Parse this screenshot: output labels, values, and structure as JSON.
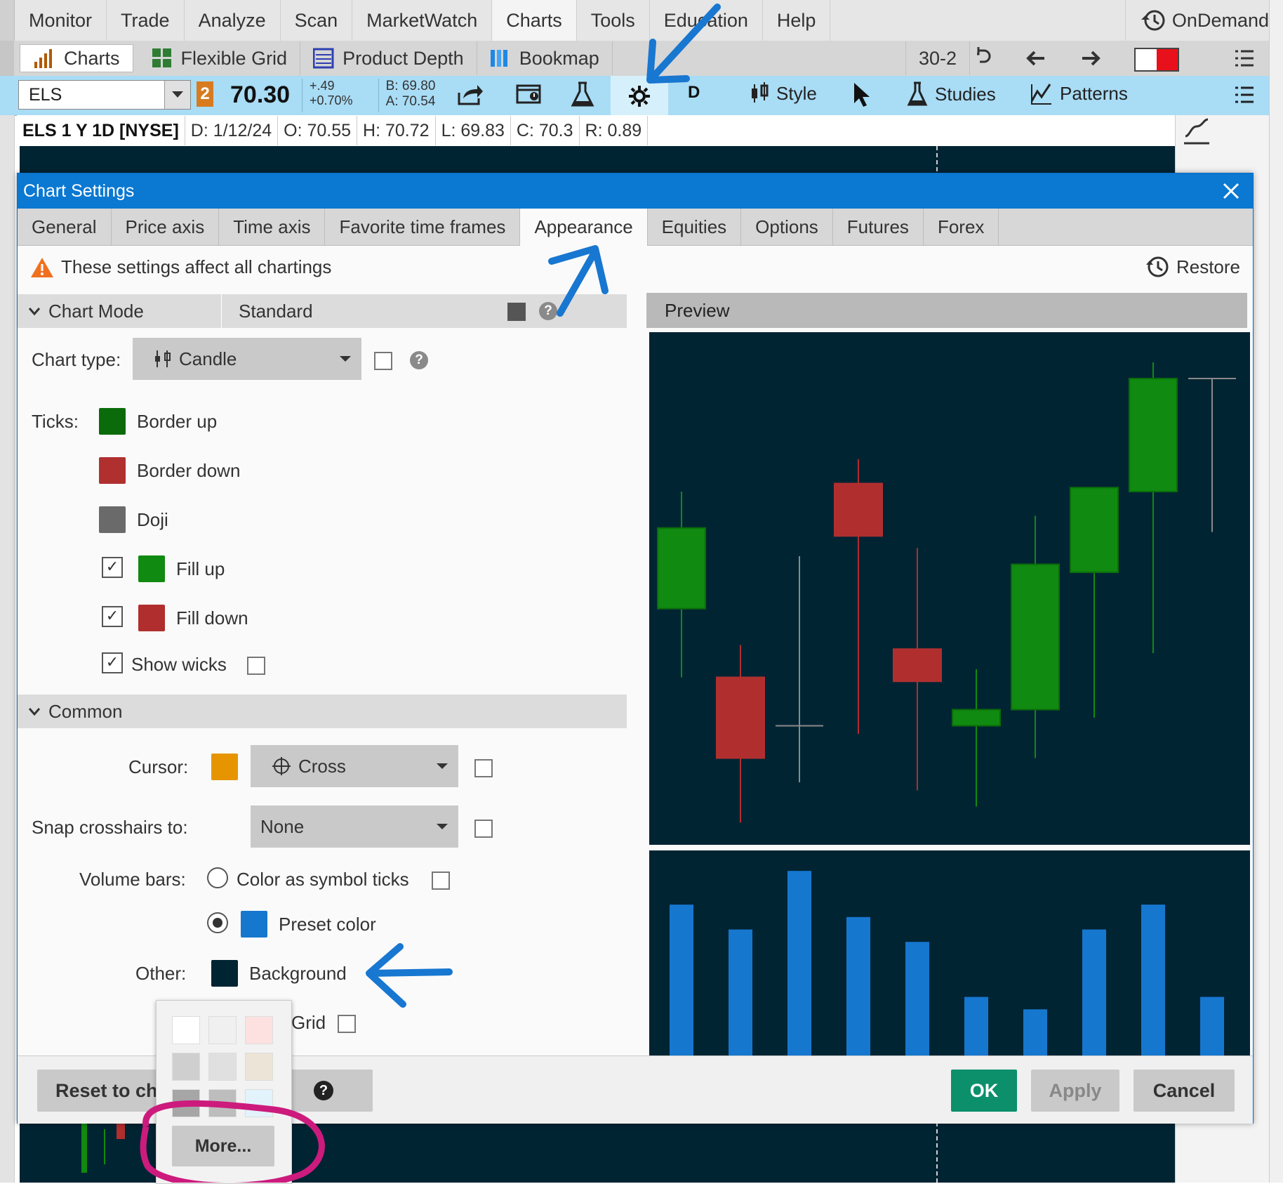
{
  "menu": {
    "items": [
      "Monitor",
      "Trade",
      "Analyze",
      "Scan",
      "MarketWatch",
      "Charts",
      "Tools",
      "Education",
      "Help"
    ],
    "ondemand": "OnDemand"
  },
  "toolbar": {
    "charts": "Charts",
    "flexible_grid": "Flexible Grid",
    "product_depth": "Product Depth",
    "bookmap": "Bookmap",
    "grid_size": "30-2"
  },
  "symbol_bar": {
    "symbol": "ELS",
    "link_number": "2",
    "price": "70.30",
    "change": "+.49",
    "change_pct": "+0.70%",
    "bid": "B: 69.80",
    "ask": "A: 70.54",
    "aggregation": "D",
    "style": "Style",
    "studies": "Studies",
    "patterns": "Patterns"
  },
  "info_bar": {
    "title": "ELS 1 Y 1D [NYSE]",
    "date": "D: 1/12/24",
    "open": "O: 70.55",
    "high": "H: 70.72",
    "low": "L: 69.83",
    "close": "C: 70.3",
    "range": "R: 0.89"
  },
  "dialog": {
    "title": "Chart Settings",
    "tabs": [
      "General",
      "Price axis",
      "Time axis",
      "Favorite time frames",
      "Appearance",
      "Equities",
      "Options",
      "Futures",
      "Forex"
    ],
    "active_tab": "Appearance",
    "warning": "These settings affect all chartings",
    "restore": "Restore",
    "chart_mode": {
      "header": "Chart Mode",
      "value": "Standard"
    },
    "chart_type": {
      "label": "Chart type:",
      "value": "Candle"
    },
    "ticks": {
      "label": "Ticks:",
      "border_up": "Border up",
      "border_down": "Border down",
      "doji": "Doji",
      "fill_up": "Fill up",
      "fill_down": "Fill down",
      "show_wicks": "Show wicks"
    },
    "common": {
      "header": "Common",
      "cursor_label": "Cursor:",
      "cursor_value": "Cross",
      "snap_label": "Snap crosshairs to:",
      "snap_value": "None",
      "volume_label": "Volume bars:",
      "volume_opt1": "Color as symbol ticks",
      "volume_opt2": "Preset color",
      "other_label": "Other:",
      "background": "Background",
      "grid": "Grid"
    },
    "preview": "Preview",
    "buttons": {
      "reset": "Reset to ch",
      "ok": "OK",
      "apply": "Apply",
      "cancel": "Cancel"
    },
    "color_popup": {
      "more": "More...",
      "swatches": [
        "#ffffff",
        "#f0f0f0",
        "#fde0e0",
        "#cfcfcf",
        "#e0e0e0",
        "#ece4d6",
        "#a6a6a6",
        "#bdbdbd",
        "#e3f3fb"
      ]
    }
  },
  "colors": {
    "border_up": "#0b6b0b",
    "border_down": "#b03030",
    "doji": "#6a6a6a",
    "fill_up": "#108a10",
    "fill_down": "#b02e2e",
    "cursor": "#e69500",
    "volume": "#1677cf",
    "background": "#012433",
    "accent": "#0b78d1",
    "ok": "#0c8f6b",
    "annotation_blue": "#1877d0",
    "annotation_pink": "#cc1b7d"
  },
  "preview_chart": {
    "candles": [
      {
        "o": 37.5,
        "c": 27.5,
        "h": 42,
        "l": 19,
        "up": true
      },
      {
        "o": 19,
        "c": 9,
        "h": 23,
        "l": 1,
        "up": false
      },
      {
        "o": 13,
        "c": 13,
        "h": 34,
        "l": 6,
        "up": null
      },
      {
        "o": 43,
        "c": 36.5,
        "h": 46,
        "l": 12,
        "up": false
      },
      {
        "o": 22.5,
        "c": 18.5,
        "h": 35,
        "l": 5,
        "up": false
      },
      {
        "o": 13,
        "c": 15,
        "h": 20,
        "l": 3,
        "up": true
      },
      {
        "o": 15,
        "c": 33,
        "h": 39,
        "l": 9,
        "up": true
      },
      {
        "o": 32,
        "c": 42.5,
        "h": 42,
        "l": 14,
        "up": true
      },
      {
        "o": 42,
        "c": 56,
        "h": 58,
        "l": 22,
        "up": true
      },
      {
        "o": 56,
        "c": 56,
        "h": 56,
        "l": 37,
        "up": null
      }
    ],
    "volumes": [
      85,
      71,
      104,
      78,
      64,
      33,
      26,
      71,
      85,
      33
    ]
  }
}
